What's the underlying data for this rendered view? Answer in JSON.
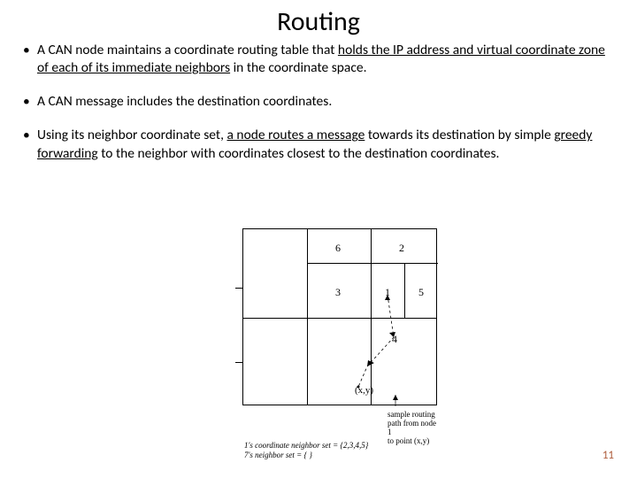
{
  "title": "Routing",
  "bullets": {
    "b1_pre": "A CAN node maintains a coordinate routing table that ",
    "b1_u": "holds the IP address and virtual coordinate zone of each of its immediate neighbors",
    "b1_post": " in the coordinate space.",
    "b2": "A CAN message includes the destination coordinates.",
    "b3_pre": "Using its neighbor coordinate set, ",
    "b3_u1": "a node routes a message",
    "b3_mid": " towards its destination by simple ",
    "b3_u2": "greedy forwarding",
    "b3_post": " to the neighbor with coordinates closest to the destination coordinates."
  },
  "figure": {
    "cells": {
      "c6": "6",
      "c2": "2",
      "c3": "3",
      "c1": "1",
      "c5": "5",
      "c4": "4"
    },
    "xy": "(x,y)",
    "caption_l1": "sample routing",
    "caption_l2": "path from node 1",
    "caption_l3": "to point (x,y)",
    "neigh_l1": "1's coordinate neighbor set = {2,3,4,5}",
    "neigh_l2": "7's neighbor set = { }"
  },
  "page": "11"
}
